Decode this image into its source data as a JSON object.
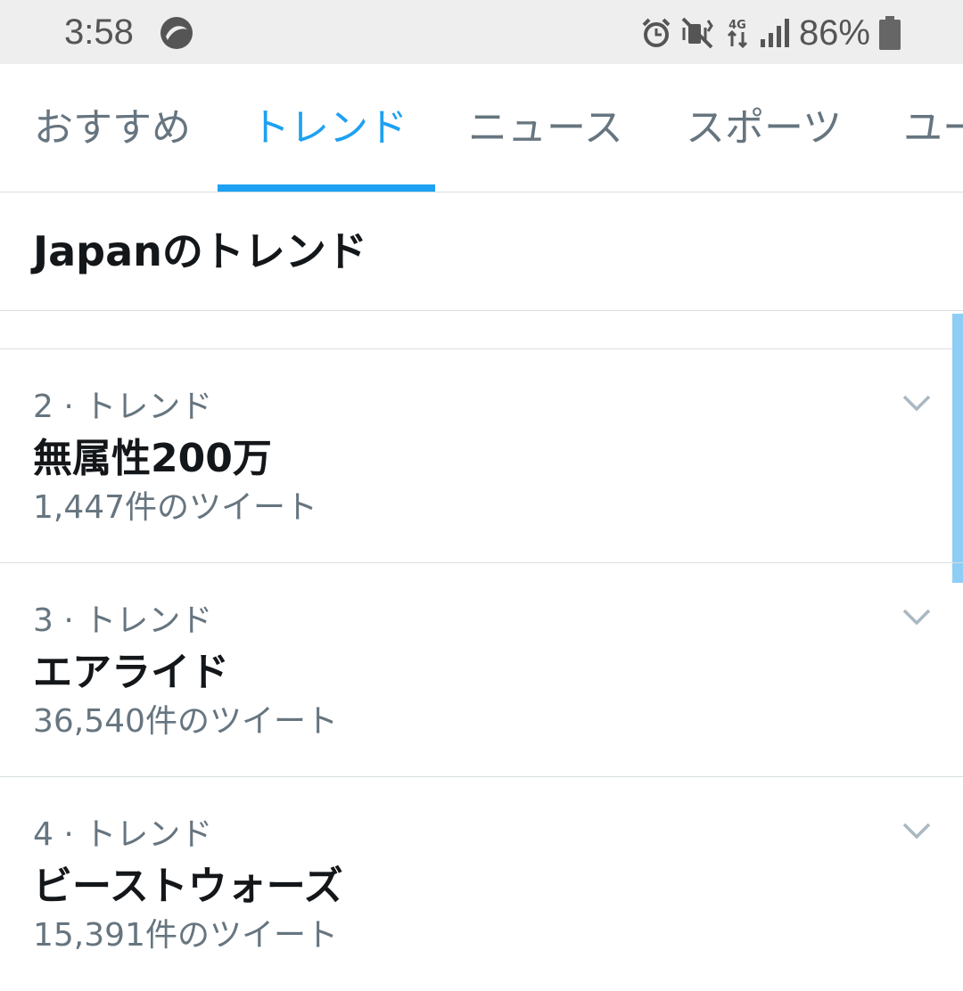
{
  "status_bar": {
    "time": "3:58",
    "network": "4G",
    "battery": "86%"
  },
  "tabs": [
    {
      "label": "おすすめ",
      "active": false
    },
    {
      "label": "トレンド",
      "active": true
    },
    {
      "label": "ニュース",
      "active": false
    },
    {
      "label": "スポーツ",
      "active": false
    },
    {
      "label": "ユー",
      "active": false
    }
  ],
  "section": {
    "title": "Japanのトレンド"
  },
  "trends": [
    {
      "meta": "2 · トレンド",
      "name": "無属性200万",
      "count": "1,447件のツイート"
    },
    {
      "meta": "3 · トレンド",
      "name": "エアライド",
      "count": "36,540件のツイート"
    },
    {
      "meta": "4 · トレンド",
      "name": "ビーストウォーズ",
      "count": "15,391件のツイート"
    }
  ],
  "colors": {
    "accent": "#1da1f2",
    "secondary_text": "#66757f",
    "primary_text": "#14171a",
    "divider": "#d9dee2",
    "status_bar_bg": "#eeeeee"
  }
}
